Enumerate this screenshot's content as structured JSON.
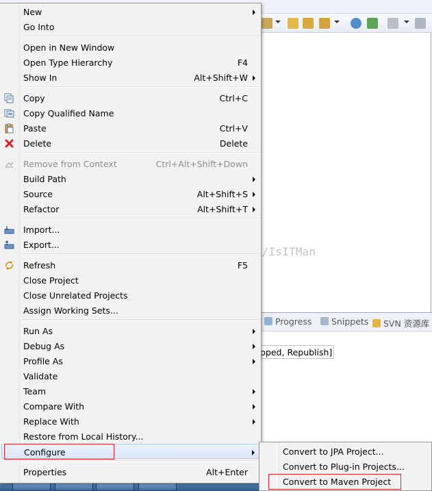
{
  "menu": {
    "items": [
      {
        "label": "New",
        "shortcut": "",
        "submenu": true
      },
      {
        "label": "Go Into",
        "shortcut": ""
      },
      {
        "label": "Open in New Window",
        "shortcut": ""
      },
      {
        "label": "Open Type Hierarchy",
        "shortcut": "F4"
      },
      {
        "label": "Show In",
        "shortcut": "Alt+Shift+W",
        "submenu": true
      },
      {
        "label": "Copy",
        "shortcut": "Ctrl+C",
        "icon": "copy-icon"
      },
      {
        "label": "Copy Qualified Name",
        "shortcut": "",
        "icon": "copy-qualified-name-icon"
      },
      {
        "label": "Paste",
        "shortcut": "Ctrl+V",
        "icon": "paste-icon"
      },
      {
        "label": "Delete",
        "shortcut": "Delete",
        "icon": "delete-icon"
      },
      {
        "label": "Remove from Context",
        "shortcut": "Ctrl+Alt+Shift+Down",
        "disabled": true,
        "icon": "remove-context-icon"
      },
      {
        "label": "Build Path",
        "shortcut": "",
        "submenu": true
      },
      {
        "label": "Source",
        "shortcut": "Alt+Shift+S",
        "submenu": true
      },
      {
        "label": "Refactor",
        "shortcut": "Alt+Shift+T",
        "submenu": true
      },
      {
        "label": "Import...",
        "shortcut": "",
        "icon": "import-icon"
      },
      {
        "label": "Export...",
        "shortcut": "",
        "icon": "export-icon"
      },
      {
        "label": "Refresh",
        "shortcut": "F5",
        "icon": "refresh-icon"
      },
      {
        "label": "Close Project",
        "shortcut": ""
      },
      {
        "label": "Close Unrelated Projects",
        "shortcut": ""
      },
      {
        "label": "Assign Working Sets...",
        "shortcut": ""
      },
      {
        "label": "Run As",
        "shortcut": "",
        "submenu": true
      },
      {
        "label": "Debug As",
        "shortcut": "",
        "submenu": true
      },
      {
        "label": "Profile As",
        "shortcut": "",
        "submenu": true
      },
      {
        "label": "Validate",
        "shortcut": ""
      },
      {
        "label": "Team",
        "shortcut": "",
        "submenu": true
      },
      {
        "label": "Compare With",
        "shortcut": "",
        "submenu": true
      },
      {
        "label": "Replace With",
        "shortcut": "",
        "submenu": true
      },
      {
        "label": "Restore from Local History...",
        "shortcut": ""
      },
      {
        "label": "Configure",
        "shortcut": "",
        "submenu": true,
        "highlighted": true
      },
      {
        "label": "Properties",
        "shortcut": "Alt+Enter"
      }
    ]
  },
  "submenu": {
    "items": [
      {
        "label": "Convert to JPA Project..."
      },
      {
        "label": "Convert to Plug-in Projects..."
      },
      {
        "label": "Convert to Maven Project"
      }
    ]
  },
  "panel_tabs": [
    {
      "label": "Progress",
      "icon": "progress-icon"
    },
    {
      "label": "Snippets",
      "icon": "snippets-icon"
    },
    {
      "label": "SVN 资源库",
      "icon": "svn-repository-icon"
    }
  ],
  "server_status": "pped, Republish]",
  "watermark": "http://blog.csdn.net/IsITMan",
  "colors": {
    "highlight_border": "#aecdf0",
    "annotation_red": "#e0282d",
    "menu_bg": "#f2f2f2"
  }
}
